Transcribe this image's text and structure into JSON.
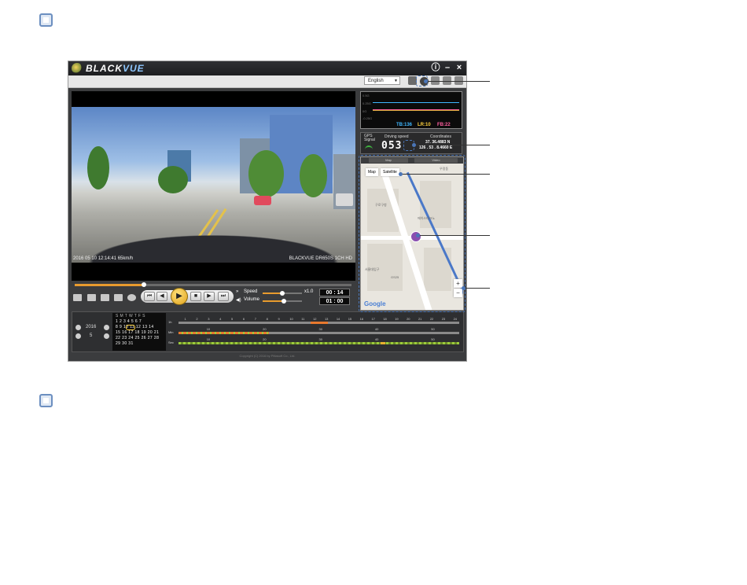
{
  "app": {
    "logo_text": "BLACK",
    "logo_accent": "VUE",
    "info_icon": "ⓘ",
    "minimize_icon": "–",
    "close_icon": "×"
  },
  "toolbar": {
    "language": "English"
  },
  "video": {
    "overlay_left": "2016 05 10  12:14:41   65km/h",
    "overlay_right": "BLACKVUE DR650S 1CH HD"
  },
  "controls": {
    "speed_label": "Speed",
    "speed_value": "x1.0",
    "volume_label": "Volume",
    "time_current": "00 : 14",
    "time_total": "01 : 00",
    "progress": 0.25
  },
  "graph": {
    "legend": [
      {
        "text": "TB:136",
        "color": "#3fb7ff"
      },
      {
        "text": "LR:10",
        "color": "#ffd23f"
      },
      {
        "text": "FB:22",
        "color": "#ff5fa0"
      }
    ]
  },
  "gps": {
    "signal_label": "GPS Signal",
    "speed_label": "Driving speed",
    "speed_value": "053",
    "coords_label": "Coordinates",
    "lat": "37. 36.4883 N",
    "lon": "126 . 53 . 8.4660 E"
  },
  "map": {
    "tab_left": "Map",
    "tab_right": "Video",
    "type_map": "Map",
    "type_satellite": "Satellite",
    "labels": [
      "우정동",
      "구로구청",
      "에이스테크노",
      "GS25",
      "서울대입구"
    ],
    "logo": "Google",
    "zoom_in": "+",
    "zoom_out": "−"
  },
  "calendar": {
    "year": "2016",
    "month": "5",
    "header": "S M T W T F S",
    "rows": [
      "1  2  3  4  5  6  7",
      "8  9 10 11 12 13 14",
      "15 16 17 18 19 20 21",
      "22 23 24 25 26 27 28",
      "29 30 31"
    ]
  },
  "timeline": {
    "labels": [
      "1h",
      "Min",
      "Sec"
    ],
    "hours": [
      "1",
      "2",
      "3",
      "4",
      "5",
      "6",
      "7",
      "8",
      "9",
      "10",
      "11",
      "12",
      "13",
      "14",
      "15",
      "16",
      "17",
      "18",
      "19",
      "20",
      "21",
      "22",
      "23",
      "24"
    ],
    "min_ticks": [
      "10",
      "20",
      "30",
      "40",
      "50"
    ],
    "sec_ticks": [
      "10",
      "20",
      "30",
      "40",
      "50"
    ]
  },
  "footer": {
    "copyright": "Copyright (C) 2016 by Pittasoft Co., Ltd."
  }
}
